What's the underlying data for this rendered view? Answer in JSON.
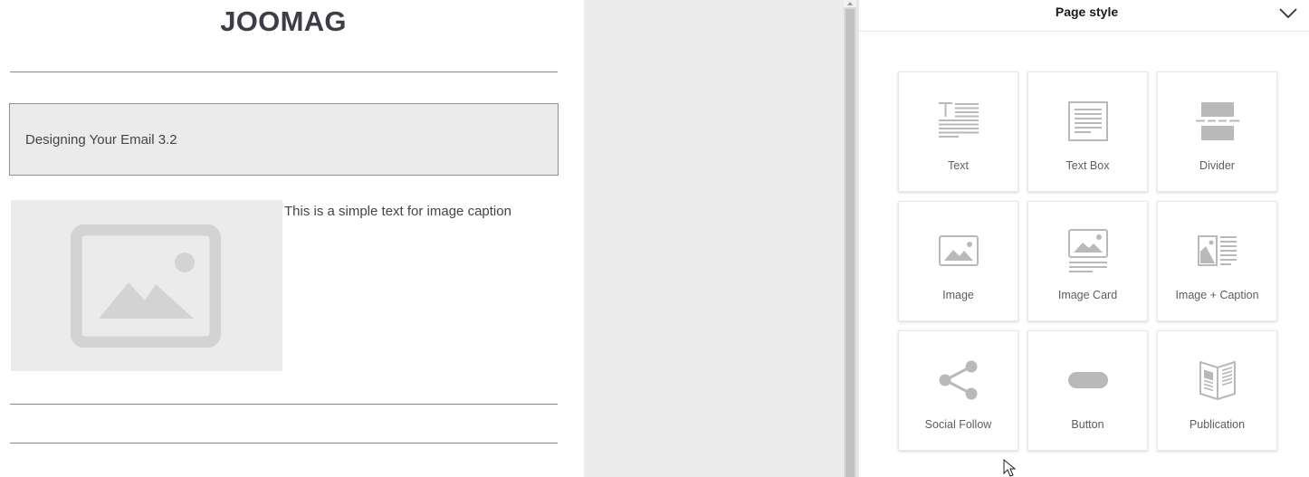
{
  "email": {
    "brand": "JOOMAG",
    "text_block": "Designing Your Email 3.2",
    "image_caption": "This is a simple text for image caption"
  },
  "panel": {
    "title": "Page style",
    "tiles": [
      {
        "label": "Text",
        "icon": "text-icon"
      },
      {
        "label": "Text Box",
        "icon": "text-box-icon"
      },
      {
        "label": "Divider",
        "icon": "divider-icon"
      },
      {
        "label": "Image",
        "icon": "image-icon"
      },
      {
        "label": "Image Card",
        "icon": "image-card-icon"
      },
      {
        "label": "Image + Caption",
        "icon": "image-caption-icon"
      },
      {
        "label": "Social Follow",
        "icon": "share-icon"
      },
      {
        "label": "Button",
        "icon": "button-icon"
      },
      {
        "label": "Publication",
        "icon": "publication-icon"
      }
    ]
  },
  "colors": {
    "icon_gray": "#b9b9b9",
    "placeholder_bg": "#ebebeb",
    "brand_text": "#3d3d49"
  }
}
